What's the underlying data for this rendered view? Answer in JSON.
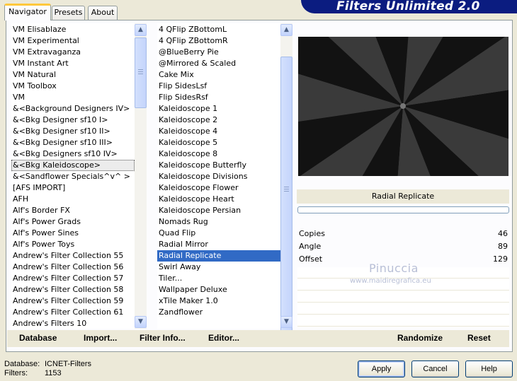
{
  "tabs": [
    {
      "label": "Navigator",
      "active": true
    },
    {
      "label": "Presets",
      "active": false
    },
    {
      "label": "About",
      "active": false
    }
  ],
  "banner_title": "Filters Unlimited 2.0",
  "categories": {
    "items": [
      "VM Elisablaze",
      "VM Experimental",
      "VM Extravaganza",
      "VM Instant Art",
      "VM Natural",
      "VM Toolbox",
      "VM",
      "&<Background Designers IV>",
      "&<Bkg Designer sf10 I>",
      "&<Bkg Designer sf10 II>",
      "&<Bkg Designer sf10 III>",
      "&<Bkg Designers sf10 IV>",
      "&<Bkg Kaleidoscope>",
      "&<Sandflower Specials^v^ >",
      "[AFS IMPORT]",
      "AFH",
      "Alf's Border FX",
      "Alf's Power Grads",
      "Alf's Power Sines",
      "Alf's Power Toys",
      "Andrew's Filter Collection 55",
      "Andrew's Filter Collection 56",
      "Andrew's Filter Collection 57",
      "Andrew's Filter Collection 58",
      "Andrew's Filter Collection 59",
      "Andrew's Filter Collection 61",
      "Andrew's Filters 10"
    ],
    "focused_index": 12
  },
  "filters": {
    "items": [
      "4 QFlip ZBottomL",
      "4 QFlip ZBottomR",
      "@BlueBerry Pie",
      "@Mirrored & Scaled",
      "Cake Mix",
      "Flip SidesLsf",
      "Flip SidesRsf",
      "Kaleidoscope 1",
      "Kaleidoscope 2",
      "Kaleidoscope 4",
      "Kaleidoscope 5",
      "Kaleidoscope 8",
      "Kaleidoscope Butterfly",
      "Kaleidoscope Divisions",
      "Kaleidoscope Flower",
      "Kaleidoscope Heart",
      "Kaleidoscope Persian",
      "Nomads Rug",
      "Quad Flip",
      "Radial Mirror",
      "Radial Replicate",
      "Swirl Away",
      "Tiler...",
      "Wallpaper Deluxe",
      "xTile Maker 1.0",
      "Zandflower"
    ],
    "selected_index": 20
  },
  "selected_filter_name": "Radial Replicate",
  "parameters": [
    {
      "label": "Copies",
      "value": "46"
    },
    {
      "label": "Angle",
      "value": "89"
    },
    {
      "label": "Offset",
      "value": "129"
    }
  ],
  "watermark": {
    "name": "Pinuccia",
    "site": "www.maidiregrafica.eu"
  },
  "bottom_buttons": {
    "database": "Database",
    "import": "Import...",
    "filter_info": "Filter Info...",
    "editor": "Editor...",
    "randomize": "Randomize",
    "reset": "Reset"
  },
  "status": {
    "database_label": "Database:",
    "database_value": "ICNET-Filters",
    "filters_label": "Filters:",
    "filters_value": "1153"
  },
  "dialog_buttons": {
    "apply": "Apply",
    "cancel": "Cancel",
    "help": "Help"
  }
}
